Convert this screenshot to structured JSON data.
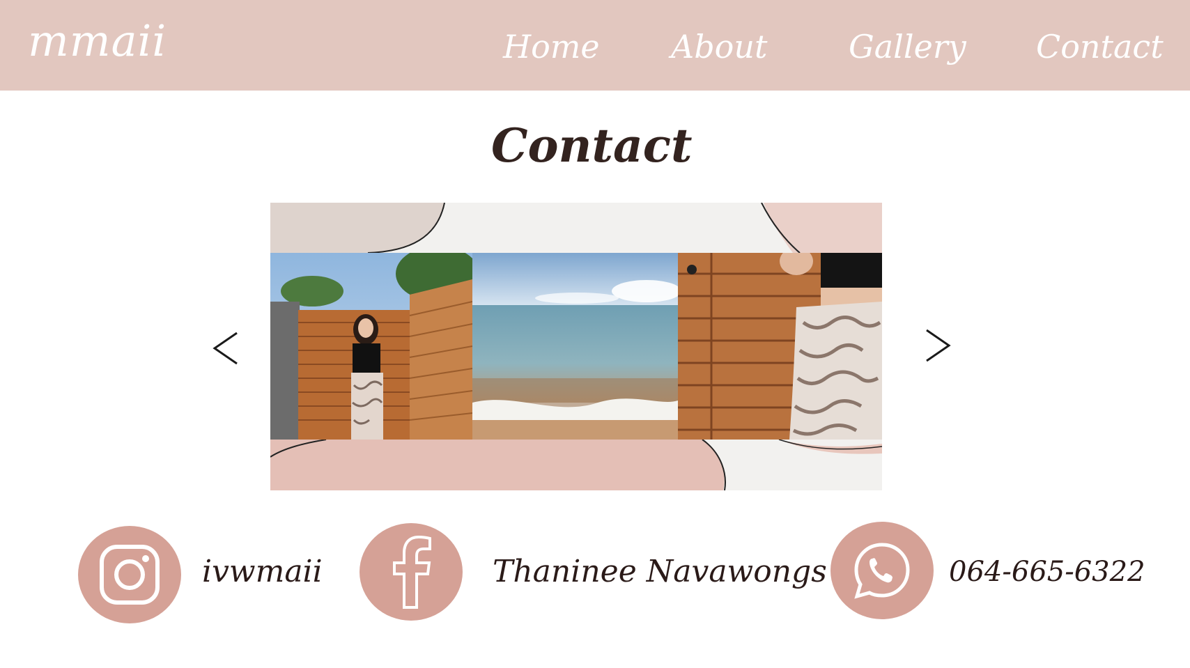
{
  "brand": {
    "logo": "mmaii"
  },
  "nav": {
    "items": [
      {
        "label": "Home"
      },
      {
        "label": "About"
      },
      {
        "label": "Gallery"
      },
      {
        "label": "Contact"
      }
    ]
  },
  "page": {
    "title": "Contact"
  },
  "carousel": {
    "prev_icon": "chevron-left-icon",
    "next_icon": "chevron-right-icon",
    "photos": [
      {
        "subject": "woman-by-wooden-gate"
      },
      {
        "subject": "sea-shore"
      },
      {
        "subject": "swirl-pants-detail"
      }
    ]
  },
  "contacts": [
    {
      "icon": "instagram-icon",
      "text": "ivwmaii"
    },
    {
      "icon": "facebook-icon",
      "text": "Thaninee Navawongs"
    },
    {
      "icon": "whatsapp-icon",
      "text": "064-665-6322"
    }
  ],
  "colors": {
    "header_bg": "#e2c7bf",
    "accent": "#d5a196",
    "text_dark": "#33231f"
  }
}
